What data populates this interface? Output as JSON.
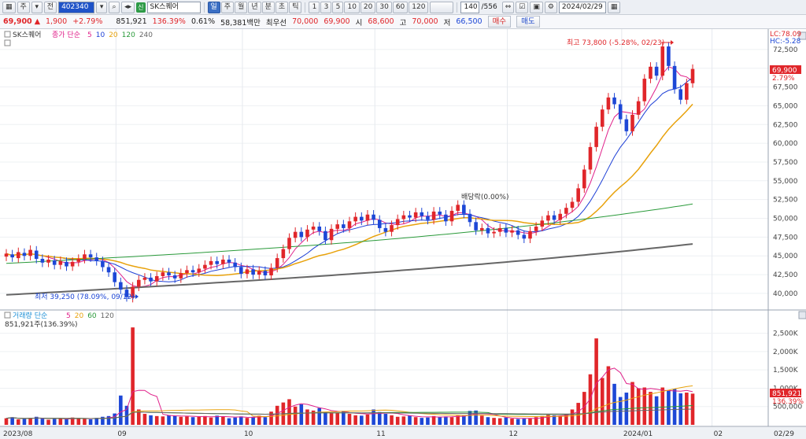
{
  "toolbar": {
    "type_label": "주",
    "exchange_label": "전",
    "code": "402340",
    "name_badge": "신",
    "stock_name": "SK스퀘어",
    "period_buttons": [
      "일",
      "주",
      "월",
      "년",
      "분",
      "초",
      "틱"
    ],
    "selected_period": "일",
    "interval_buttons": [
      "1",
      "3",
      "5",
      "10",
      "20",
      "30",
      "60",
      "120"
    ],
    "count": "140",
    "total": "/556",
    "date": "2024/02/29"
  },
  "quote": {
    "price": "69,900",
    "arrow": "▲",
    "change": "1,900",
    "change_pct": "+2.79%",
    "volume": "851,921",
    "volume_ratio": "136.39%",
    "turnover": "0.61%",
    "amount": "58,381백만",
    "best_label": "최우선",
    "best_ask": "70,000",
    "best_bid": "69,900",
    "open_label": "시",
    "open": "68,600",
    "high_label": "고",
    "high": "70,000",
    "low_label": "저",
    "low": "66,500",
    "buy_label": "매수",
    "sell_label": "매도"
  },
  "price_pane": {
    "legend_name": "SK스퀘어",
    "ma_label": "종가 단순",
    "ma_periods": [
      "5",
      "10",
      "20",
      "120",
      "240"
    ],
    "ma_colors": [
      "#e0218a",
      "#1d3fd6",
      "#e8a20c",
      "#2a9a3a",
      "#666666"
    ],
    "lc_label": "LC:78.09",
    "hc_label": "HC:-5.28",
    "price_ticks": [
      "72,500",
      "70,000",
      "67,500",
      "65,000",
      "62,500",
      "60,000",
      "57,500",
      "55,000",
      "52,500",
      "50,000",
      "47,500",
      "45,000",
      "42,500",
      "40,000"
    ],
    "current_price_tag": "69,900",
    "current_pct_tag": "2.79%",
    "annot_high": "최고 73,800 (-5.28%, 02/23)",
    "annot_low": "최저 39,250 (78.09%, 09/12)",
    "annot_dividend": "배당락(0.00%)"
  },
  "volume_pane": {
    "legend": "거래량 단순",
    "ma_periods": [
      "5",
      "20",
      "60",
      "120"
    ],
    "ma_colors": [
      "#e0218a",
      "#e8a20c",
      "#2a9a3a",
      "#666666"
    ],
    "current_label": "851,921주(136.39%)",
    "vol_ticks": [
      "2,500K",
      "2,000K",
      "1,500K",
      "1,000K",
      "500,000"
    ],
    "current_volume_tag": "851,921",
    "current_pct_tag": "136.39%"
  },
  "x_axis": {
    "labels": [
      "2023/08",
      "09",
      "10",
      "11",
      "12",
      "2024/01",
      "02"
    ],
    "end_label": "02/29"
  },
  "colors": {
    "up": "#e0262a",
    "down": "#1d47d6",
    "panel_bg": "#eceff4"
  },
  "chart_data": {
    "type": "candlestick",
    "x_range": [
      "2023/08",
      "2024/02/29"
    ],
    "y_range": [
      38000,
      75000
    ],
    "candles": [
      {
        "o": 44900,
        "c": 45300
      },
      {
        "o": 45200,
        "c": 44800
      },
      {
        "o": 44700,
        "c": 45500
      },
      {
        "o": 45400,
        "c": 45000
      },
      {
        "o": 45000,
        "c": 45800
      },
      {
        "o": 45700,
        "c": 44600
      },
      {
        "o": 44600,
        "c": 44100
      },
      {
        "o": 44100,
        "c": 44500
      },
      {
        "o": 44400,
        "c": 43800
      },
      {
        "o": 43800,
        "c": 44300
      },
      {
        "o": 44200,
        "c": 43600
      },
      {
        "o": 43600,
        "c": 44200
      },
      {
        "o": 44200,
        "c": 44600
      },
      {
        "o": 44600,
        "c": 45200
      },
      {
        "o": 45200,
        "c": 44800
      },
      {
        "o": 44800,
        "c": 44300
      },
      {
        "o": 44300,
        "c": 43500
      },
      {
        "o": 43500,
        "c": 42800
      },
      {
        "o": 42800,
        "c": 41500
      },
      {
        "o": 41500,
        "c": 40500
      },
      {
        "o": 40500,
        "c": 39500
      },
      {
        "o": 39400,
        "c": 40900
      },
      {
        "o": 40900,
        "c": 41800
      },
      {
        "o": 41800,
        "c": 42100
      },
      {
        "o": 42100,
        "c": 41600
      },
      {
        "o": 41600,
        "c": 42300
      },
      {
        "o": 42300,
        "c": 42800
      },
      {
        "o": 42800,
        "c": 42400
      },
      {
        "o": 42400,
        "c": 42000
      },
      {
        "o": 42000,
        "c": 42700
      },
      {
        "o": 42700,
        "c": 43100
      },
      {
        "o": 43100,
        "c": 42800
      },
      {
        "o": 42800,
        "c": 43300
      },
      {
        "o": 43300,
        "c": 43800
      },
      {
        "o": 43800,
        "c": 44300
      },
      {
        "o": 44300,
        "c": 43900
      },
      {
        "o": 43900,
        "c": 44500
      },
      {
        "o": 44500,
        "c": 44100
      },
      {
        "o": 44100,
        "c": 43500
      },
      {
        "o": 43500,
        "c": 42600
      },
      {
        "o": 42600,
        "c": 43200
      },
      {
        "o": 43200,
        "c": 42500
      },
      {
        "o": 42500,
        "c": 43000
      },
      {
        "o": 43000,
        "c": 42400
      },
      {
        "o": 42400,
        "c": 43400
      },
      {
        "o": 43400,
        "c": 44700
      },
      {
        "o": 44700,
        "c": 45900
      },
      {
        "o": 45900,
        "c": 47400
      },
      {
        "o": 47400,
        "c": 48200
      },
      {
        "o": 48200,
        "c": 47500
      },
      {
        "o": 47500,
        "c": 48500
      },
      {
        "o": 48500,
        "c": 48900
      },
      {
        "o": 48900,
        "c": 48300
      },
      {
        "o": 48300,
        "c": 47100
      },
      {
        "o": 47100,
        "c": 48600
      },
      {
        "o": 48600,
        "c": 49200
      },
      {
        "o": 49200,
        "c": 48700
      },
      {
        "o": 48700,
        "c": 49600
      },
      {
        "o": 49600,
        "c": 50200
      },
      {
        "o": 50200,
        "c": 49700
      },
      {
        "o": 49700,
        "c": 50500
      },
      {
        "o": 50500,
        "c": 49800
      },
      {
        "o": 49800,
        "c": 48700
      },
      {
        "o": 48700,
        "c": 48200
      },
      {
        "o": 48200,
        "c": 49100
      },
      {
        "o": 49100,
        "c": 49900
      },
      {
        "o": 49900,
        "c": 50400
      },
      {
        "o": 50400,
        "c": 50100
      },
      {
        "o": 50100,
        "c": 50800
      },
      {
        "o": 50800,
        "c": 50300
      },
      {
        "o": 50300,
        "c": 49800
      },
      {
        "o": 49800,
        "c": 50900
      },
      {
        "o": 50900,
        "c": 50500
      },
      {
        "o": 50500,
        "c": 49600
      },
      {
        "o": 49600,
        "c": 51000
      },
      {
        "o": 51000,
        "c": 51800
      },
      {
        "o": 51800,
        "c": 50600
      },
      {
        "o": 50600,
        "c": 49500
      },
      {
        "o": 49500,
        "c": 48400
      },
      {
        "o": 48400,
        "c": 48700
      },
      {
        "o": 48700,
        "c": 48000
      },
      {
        "o": 48000,
        "c": 48200
      },
      {
        "o": 48200,
        "c": 48700
      },
      {
        "o": 48700,
        "c": 48100
      },
      {
        "o": 48100,
        "c": 48400
      },
      {
        "o": 48400,
        "c": 47800
      },
      {
        "o": 47800,
        "c": 47300
      },
      {
        "o": 47300,
        "c": 48300
      },
      {
        "o": 48300,
        "c": 48900
      },
      {
        "o": 48900,
        "c": 49700
      },
      {
        "o": 49700,
        "c": 50400
      },
      {
        "o": 50400,
        "c": 49800
      },
      {
        "o": 49800,
        "c": 50600
      },
      {
        "o": 50600,
        "c": 51400
      },
      {
        "o": 51400,
        "c": 52200
      },
      {
        "o": 52200,
        "c": 54000
      },
      {
        "o": 54000,
        "c": 56500
      },
      {
        "o": 56500,
        "c": 59500
      },
      {
        "o": 59500,
        "c": 62200
      },
      {
        "o": 62200,
        "c": 64500
      },
      {
        "o": 64500,
        "c": 66100
      },
      {
        "o": 66100,
        "c": 65200
      },
      {
        "o": 65200,
        "c": 63200
      },
      {
        "o": 63200,
        "c": 61600
      },
      {
        "o": 61600,
        "c": 63800
      },
      {
        "o": 63800,
        "c": 65600
      },
      {
        "o": 65600,
        "c": 68600
      },
      {
        "o": 68600,
        "c": 70200
      },
      {
        "o": 70200,
        "c": 69000
      },
      {
        "o": 69000,
        "c": 72900
      },
      {
        "o": 72900,
        "c": 70300
      },
      {
        "o": 70300,
        "c": 67200
      },
      {
        "o": 67200,
        "c": 65800
      },
      {
        "o": 65800,
        "c": 68000
      },
      {
        "o": 68000,
        "c": 69900
      }
    ],
    "volume": [
      180,
      210,
      150,
      160,
      190,
      220,
      170,
      140,
      160,
      180,
      150,
      200,
      170,
      160,
      150,
      190,
      220,
      240,
      310,
      800,
      520,
      2660,
      420,
      300,
      260,
      240,
      230,
      260,
      250,
      220,
      230,
      210,
      220,
      240,
      200,
      250,
      230,
      180,
      200,
      230,
      190,
      220,
      250,
      210,
      360,
      520,
      610,
      700,
      500,
      560,
      420,
      390,
      460,
      350,
      320,
      330,
      380,
      300,
      260,
      250,
      280,
      420,
      350,
      300,
      260,
      220,
      230,
      250,
      210,
      190,
      200,
      240,
      220,
      230,
      210,
      250,
      260,
      380,
      390,
      250,
      210,
      190,
      180,
      200,
      170,
      160,
      170,
      180,
      210,
      240,
      270,
      260,
      250,
      280,
      420,
      600,
      900,
      1380,
      2360,
      1280,
      1600,
      1120,
      760,
      880,
      1170,
      1000,
      1020,
      900,
      780,
      1020,
      950,
      980,
      860,
      880,
      852
    ]
  }
}
